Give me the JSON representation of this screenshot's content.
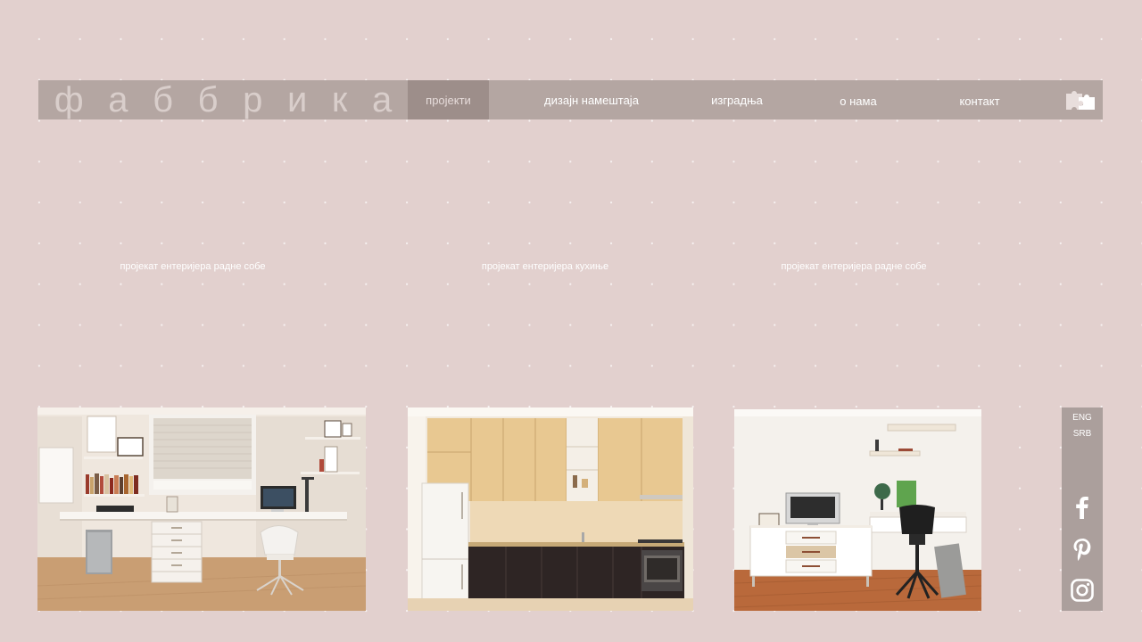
{
  "header": {
    "logo_letters": [
      "ф",
      "а",
      "б",
      "б",
      "р",
      "и",
      "к",
      "а"
    ],
    "nav": [
      {
        "label": "пројекти",
        "active": true
      },
      {
        "label": "дизајн намештаја",
        "active": false
      },
      {
        "label": "изградња",
        "active": false
      },
      {
        "label": "о нама",
        "active": false
      },
      {
        "label": "контакт",
        "active": false
      }
    ],
    "puzzle_icon": "puzzle-icon"
  },
  "projects": [
    {
      "caption": "пројекат ентеријера радне собе"
    },
    {
      "caption": "пројекат ентеријера кухиње"
    },
    {
      "caption": "пројекат ентеријера радне собе"
    }
  ],
  "sidebar": {
    "languages": [
      "ENG",
      "SRB"
    ],
    "social": [
      "facebook-icon",
      "pinterest-icon",
      "instagram-icon"
    ]
  },
  "colors": {
    "background": "#e2d0ce",
    "navbar": "#b4a6a2",
    "nav_active": "#9d8e8a",
    "side_panel": "#ab9f9c"
  }
}
